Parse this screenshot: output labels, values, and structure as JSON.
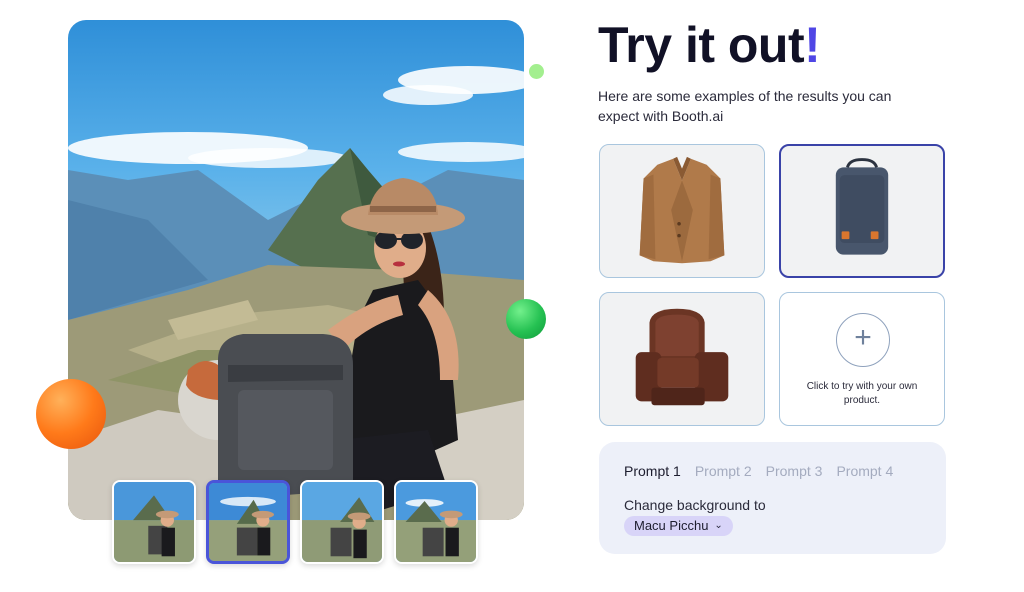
{
  "header": {
    "title": "Try it out",
    "title_accent": "!",
    "subtitle": "Here are some examples of the results you can expect with Booth.ai"
  },
  "colors": {
    "accent": "#4f46e5",
    "card_selected_border": "#3a43a8",
    "prompt_panel_bg": "#edf0f9",
    "dropdown_bg": "#d8d4f8"
  },
  "gallery": {
    "selected_thumbnail": 2,
    "thumbnail_count": 4
  },
  "products": {
    "items": [
      {
        "name": "jacket",
        "selected": false
      },
      {
        "name": "backpack",
        "selected": true
      },
      {
        "name": "recliner-chair",
        "selected": false
      }
    ],
    "upload_icon": "plus-icon",
    "upload_text": "Click to try with your own product."
  },
  "prompt": {
    "tabs": [
      "Prompt 1",
      "Prompt 2",
      "Prompt 3",
      "Prompt 4"
    ],
    "active_tab": 0,
    "label": "Change background to",
    "dropdown_value": "Macu Picchu",
    "dropdown_icon": "chevron-down-icon"
  }
}
